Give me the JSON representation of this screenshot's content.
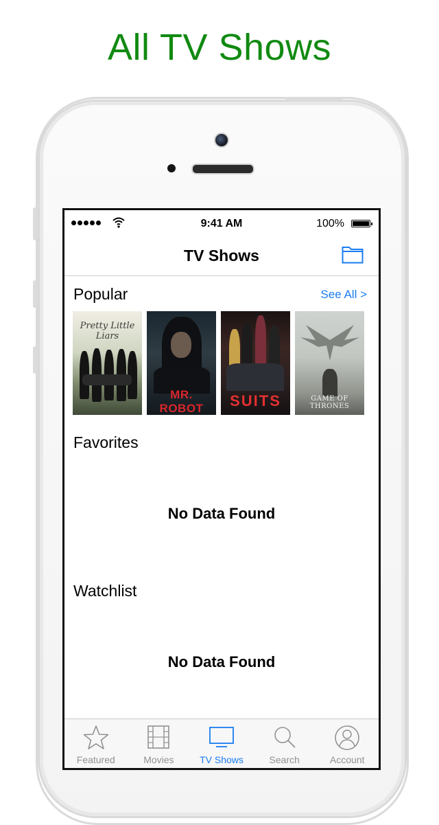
{
  "headline": "All TV Shows",
  "status_bar": {
    "time": "9:41 AM",
    "battery": "100%"
  },
  "nav": {
    "title": "TV Shows"
  },
  "sections": {
    "popular": {
      "title": "Popular",
      "see_all": "See All >"
    },
    "favorites": {
      "title": "Favorites",
      "empty": "No Data Found"
    },
    "watchlist": {
      "title": "Watchlist",
      "empty": "No Data Found"
    }
  },
  "posters": [
    {
      "title": "Pretty Little Liars"
    },
    {
      "title": "MR. ROBOT"
    },
    {
      "title": "SUITS"
    },
    {
      "title": "GAME OF THRONES"
    }
  ],
  "tabs": [
    {
      "label": "Featured",
      "icon": "star-icon",
      "active": false
    },
    {
      "label": "Movies",
      "icon": "film-icon",
      "active": false
    },
    {
      "label": "TV Shows",
      "icon": "tv-icon",
      "active": true
    },
    {
      "label": "Search",
      "icon": "search-icon",
      "active": false
    },
    {
      "label": "Account",
      "icon": "account-icon",
      "active": false
    }
  ],
  "colors": {
    "headline": "#118a11",
    "accent": "#1a7cf2",
    "inactive": "#929292"
  }
}
